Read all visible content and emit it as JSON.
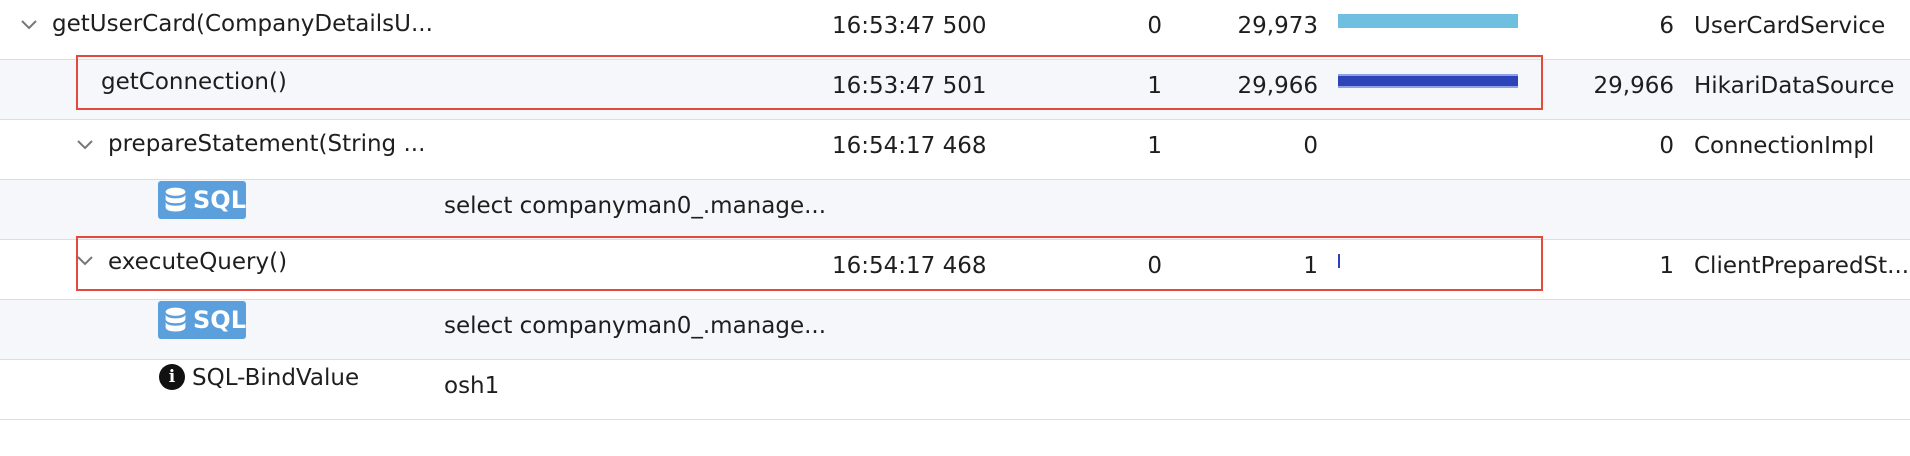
{
  "rows": [
    {
      "method": "getUserCard(CompanyDetailsU...",
      "time": "16:53:47 500",
      "count": "0",
      "duration": "29,973",
      "self": "6",
      "class": "UserCardService",
      "bar_fraction": 1.0,
      "bar_color": "#6fbfe0"
    },
    {
      "method": "getConnection()",
      "time": "16:53:47 501",
      "count": "1",
      "duration": "29,966",
      "self": "29,966",
      "class": "HikariDataSource",
      "bar_fraction": 1.0,
      "bar_color": "#2d43b8"
    },
    {
      "method": "prepareStatement(String ...",
      "time": "16:54:17 468",
      "count": "1",
      "duration": "0",
      "self": "0",
      "class": "ConnectionImpl"
    },
    {
      "badge": "SQL",
      "detail": "select companyman0_.manage..."
    },
    {
      "method": "executeQuery()",
      "time": "16:54:17 468",
      "count": "0",
      "duration": "1",
      "self": "1",
      "class": "ClientPreparedSt...",
      "bar_fraction": 0.01,
      "bar_color": "#2d43b8"
    },
    {
      "badge": "SQL",
      "detail": "select companyman0_.manage..."
    },
    {
      "info_label": "SQL-BindValue",
      "detail": "osh1"
    }
  ],
  "colors": {
    "highlight": "#e24b3b",
    "badge": "#5b9fdc"
  },
  "icons": {
    "expand": "chevron-down-icon",
    "sql": "database-icon",
    "info": "info-icon"
  }
}
